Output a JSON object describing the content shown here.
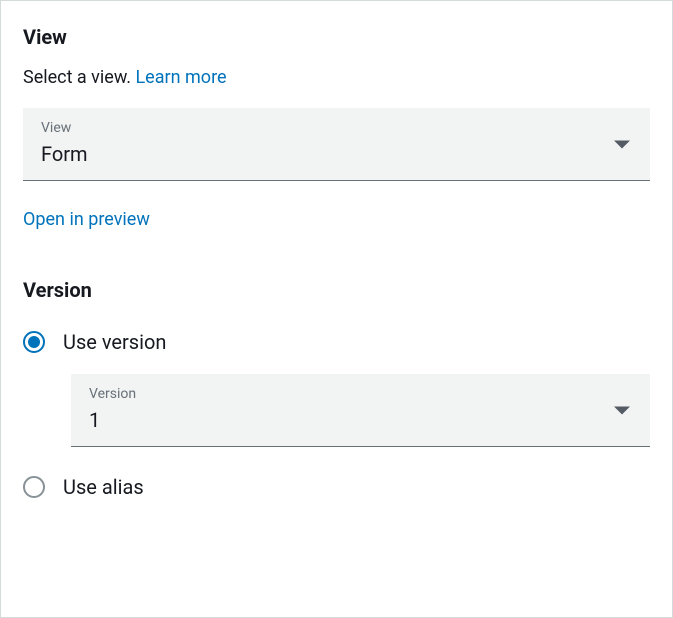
{
  "view": {
    "title": "View",
    "subtitle_static": "Select a view. ",
    "subtitle_link": "Learn more",
    "select": {
      "label": "View",
      "value": "Form"
    },
    "open_preview": "Open in preview"
  },
  "version": {
    "title": "Version",
    "option_use_version": {
      "label": "Use version",
      "selected": true,
      "select": {
        "label": "Version",
        "value": "1"
      }
    },
    "option_use_alias": {
      "label": "Use alias",
      "selected": false
    }
  }
}
